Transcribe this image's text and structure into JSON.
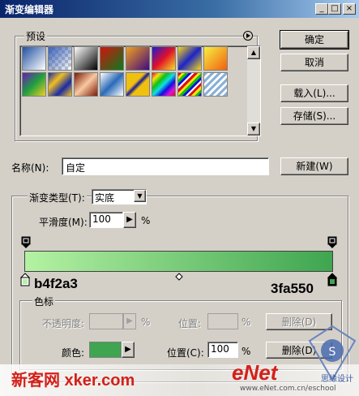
{
  "window": {
    "title": "渐变编辑器",
    "min": "_",
    "max": "□",
    "close": "×"
  },
  "presets": {
    "label": "预设",
    "menu_icon": "circle-arrow-icon"
  },
  "buttons": {
    "ok": "确定",
    "cancel": "取消",
    "load": "载入(L)...",
    "save": "存储(S)...",
    "new": "新建(W)"
  },
  "name": {
    "label": "名称(N):",
    "value": "自定"
  },
  "gradient": {
    "type_label": "渐变类型(T):",
    "type_value": "实底",
    "smooth_label": "平滑度(M):",
    "smooth_value": "100",
    "smooth_unit": "%",
    "start_color": "#b4f2a3",
    "end_color": "#3fa550",
    "start_note": "b4f2a3",
    "end_note": "3fa550"
  },
  "color_stops": {
    "legend": "色标",
    "opacity_label": "不透明度:",
    "opacity_unit": "%",
    "position_label": "位置:",
    "position_unit": "%",
    "delete1": "删除(D)",
    "color_label": "颜色:",
    "color_value": "#3fa550",
    "position2_label": "位置(C):",
    "position2_value": "100",
    "position2_unit": "%",
    "delete2": "删除(D)"
  },
  "watermarks": {
    "left": "新客网 xker.com",
    "right": "eNet",
    "right_url": "www.eNet.com.cn/eschool",
    "badge": "思缘设计"
  }
}
